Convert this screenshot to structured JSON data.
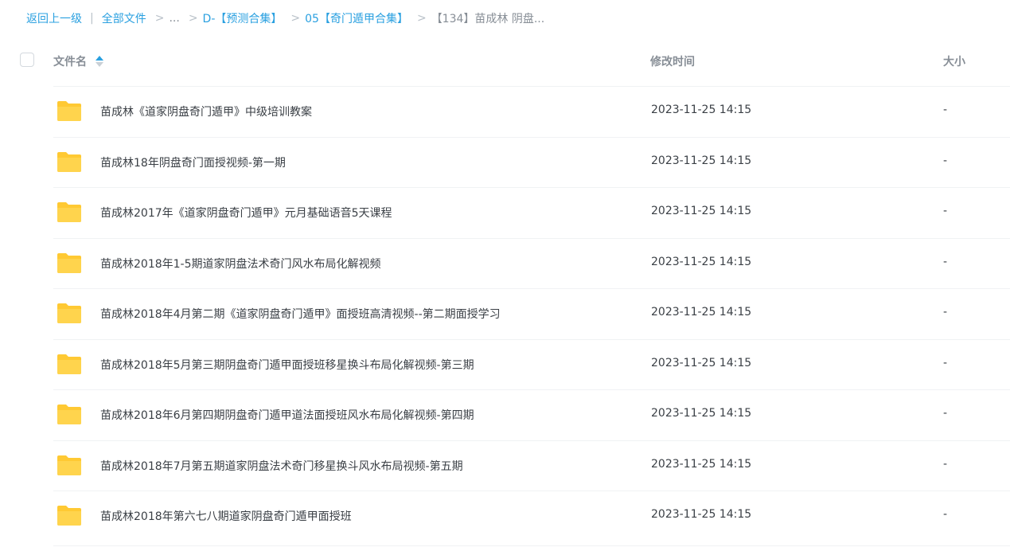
{
  "breadcrumb": {
    "back": "返回上一级",
    "separator": "|",
    "all_files": "全部文件",
    "ellipsis": "...",
    "arrow": ">",
    "level1": "D-【预测合集】",
    "level2": "05【奇门遁甲合集】",
    "current": "【134】苗成林 阴盘..."
  },
  "table": {
    "header": {
      "name": "文件名",
      "modified": "修改时间",
      "size": "大小"
    },
    "rows": [
      {
        "name": "苗成林《道家阴盘奇门遁甲》中级培训教案",
        "modified": "2023-11-25 14:15",
        "size": "-"
      },
      {
        "name": "苗成林18年阴盘奇门面授视频-第一期",
        "modified": "2023-11-25 14:15",
        "size": "-"
      },
      {
        "name": "苗成林2017年《道家阴盘奇门遁甲》元月基础语音5天课程",
        "modified": "2023-11-25 14:15",
        "size": "-"
      },
      {
        "name": "苗成林2018年1-5期道家阴盘法术奇门风水布局化解视频",
        "modified": "2023-11-25 14:15",
        "size": "-"
      },
      {
        "name": "苗成林2018年4月第二期《道家阴盘奇门遁甲》面授班高清视频--第二期面授学习",
        "modified": "2023-11-25 14:15",
        "size": "-"
      },
      {
        "name": "苗成林2018年5月第三期阴盘奇门遁甲面授班移星换斗布局化解视频-第三期",
        "modified": "2023-11-25 14:15",
        "size": "-"
      },
      {
        "name": "苗成林2018年6月第四期阴盘奇门遁甲道法面授班风水布局化解视频-第四期",
        "modified": "2023-11-25 14:15",
        "size": "-"
      },
      {
        "name": "苗成林2018年7月第五期道家阴盘法术奇门移星换斗风水布局视频-第五期",
        "modified": "2023-11-25 14:15",
        "size": "-"
      },
      {
        "name": "苗成林2018年第六七八期道家阴盘奇门遁甲面授班",
        "modified": "2023-11-25 14:15",
        "size": "-"
      }
    ]
  },
  "colors": {
    "link": "#2aa0e0",
    "folder": "#ffc933",
    "header_text": "#878e96",
    "body_text": "#3a3f45"
  },
  "icons": {
    "folder": "folder-icon",
    "sort": "sort-ascending-icon"
  }
}
